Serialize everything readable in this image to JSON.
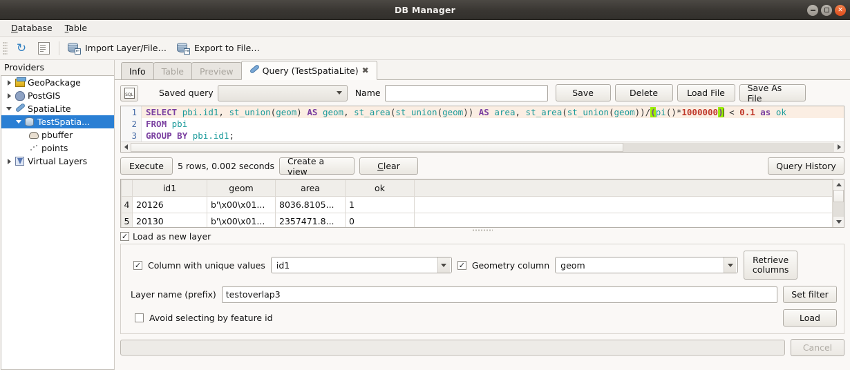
{
  "window": {
    "title": "DB Manager",
    "buttons": {
      "minimize": "minimize-icon",
      "maximize": "maximize-icon",
      "close": "close-icon"
    }
  },
  "menubar": [
    {
      "label": "Database",
      "accel": "D"
    },
    {
      "label": "Table",
      "accel": "T"
    }
  ],
  "toolbar": {
    "refresh_icon": "refresh-icon",
    "sql_window_icon": "sql-window-icon",
    "import_label": "Import Layer/File…",
    "export_label": "Export to File…"
  },
  "sidebar": {
    "title": "Providers",
    "items": [
      {
        "label": "GeoPackage",
        "icon": "geopackage-icon",
        "indent": 1,
        "expander": "collapsed",
        "selected": false
      },
      {
        "label": "PostGIS",
        "icon": "postgis-icon",
        "indent": 1,
        "expander": "collapsed",
        "selected": false
      },
      {
        "label": "SpatiaLite",
        "icon": "spatialite-icon",
        "indent": 1,
        "expander": "expanded",
        "selected": false
      },
      {
        "label": "TestSpatia...",
        "icon": "database-icon",
        "indent": 2,
        "expander": "expanded",
        "selected": true
      },
      {
        "label": "pbuffer",
        "icon": "polygon-icon",
        "indent": 3,
        "expander": "none",
        "selected": false
      },
      {
        "label": "points",
        "icon": "points-icon",
        "indent": 3,
        "expander": "none",
        "selected": false
      },
      {
        "label": "Virtual Layers",
        "icon": "virtual-layers-icon",
        "indent": 1,
        "expander": "collapsed",
        "selected": false
      }
    ]
  },
  "tabs": [
    {
      "label": "Info",
      "state": "enabled",
      "closable": false
    },
    {
      "label": "Table",
      "state": "disabled",
      "closable": false
    },
    {
      "label": "Preview",
      "state": "disabled",
      "closable": false
    },
    {
      "label": "Query (TestSpatiaLite)",
      "state": "active",
      "closable": true,
      "icon": "feather-icon",
      "close_glyph": "✖"
    }
  ],
  "query_panel": {
    "sql_button_icon": "sql-icon",
    "sql_button_text": "SQL",
    "saved_query_label": "Saved query",
    "saved_query_value": "",
    "name_label": "Name",
    "name_value": "",
    "buttons": {
      "save": "Save",
      "delete": "Delete",
      "load_file": "Load File",
      "save_as_file": "Save As File"
    },
    "editor": {
      "line_numbers": [
        "1",
        "2",
        "3"
      ],
      "lines": [
        "SELECT pbi.id1, st_union(geom) AS geom, st_area(st_union(geom)) AS area, st_area(st_union(geom))/(pi()*1000000) < 0.1 as ok",
        "FROM pbi",
        "GROUP BY pbi.id1;"
      ],
      "line1_tokens": [
        {
          "t": "SELECT",
          "c": "kw"
        },
        {
          "t": " ",
          "c": "op"
        },
        {
          "t": "pbi.id1",
          "c": "id"
        },
        {
          "t": ", ",
          "c": "op"
        },
        {
          "t": "st_union",
          "c": "fn"
        },
        {
          "t": "(",
          "c": "op"
        },
        {
          "t": "geom",
          "c": "id"
        },
        {
          "t": ") ",
          "c": "op"
        },
        {
          "t": "AS",
          "c": "kw"
        },
        {
          "t": " ",
          "c": "op"
        },
        {
          "t": "geom",
          "c": "id"
        },
        {
          "t": ", ",
          "c": "op"
        },
        {
          "t": "st_area",
          "c": "fn"
        },
        {
          "t": "(",
          "c": "op"
        },
        {
          "t": "st_union",
          "c": "fn"
        },
        {
          "t": "(",
          "c": "op"
        },
        {
          "t": "geom",
          "c": "id"
        },
        {
          "t": ")) ",
          "c": "op"
        },
        {
          "t": "AS",
          "c": "kw"
        },
        {
          "t": " ",
          "c": "op"
        },
        {
          "t": "area",
          "c": "id"
        },
        {
          "t": ", ",
          "c": "op"
        },
        {
          "t": "st_area",
          "c": "fn"
        },
        {
          "t": "(",
          "c": "op"
        },
        {
          "t": "st_union",
          "c": "fn"
        },
        {
          "t": "(",
          "c": "op"
        },
        {
          "t": "geom",
          "c": "id"
        },
        {
          "t": "))/",
          "c": "op"
        },
        {
          "t": "(",
          "c": "hl"
        },
        {
          "t": "pi",
          "c": "fn"
        },
        {
          "t": "()*",
          "c": "op"
        },
        {
          "t": "1000000",
          "c": "num"
        },
        {
          "t": ")",
          "c": "hl"
        },
        {
          "t": " < ",
          "c": "op"
        },
        {
          "t": "0.1",
          "c": "num"
        },
        {
          "t": " ",
          "c": "op"
        },
        {
          "t": "as",
          "c": "kw"
        },
        {
          "t": " ",
          "c": "op"
        },
        {
          "t": "ok",
          "c": "id"
        }
      ],
      "line2_tokens": [
        {
          "t": "FROM",
          "c": "kw"
        },
        {
          "t": " ",
          "c": "op"
        },
        {
          "t": "pbi",
          "c": "id"
        }
      ],
      "line3_tokens": [
        {
          "t": "GROUP",
          "c": "kw"
        },
        {
          "t": " ",
          "c": "op"
        },
        {
          "t": "BY",
          "c": "kw"
        },
        {
          "t": " ",
          "c": "op"
        },
        {
          "t": "pbi.id1",
          "c": "id"
        },
        {
          "t": ";",
          "c": "op"
        }
      ]
    },
    "execute_row": {
      "execute": "Execute",
      "status": "5 rows, 0.002 seconds",
      "create_view": "Create a view",
      "clear": "Clear",
      "clear_accel": "C",
      "query_history": "Query History"
    },
    "results": {
      "columns": [
        "id1",
        "geom",
        "area",
        "ok"
      ],
      "rows": [
        {
          "num": "4",
          "cells": [
            "20126",
            "b'\\x00\\x01...",
            "8036.8105...",
            "1"
          ]
        },
        {
          "num": "5",
          "cells": [
            "20130",
            "b'\\x00\\x01...",
            "2357471.8...",
            "0"
          ]
        }
      ]
    },
    "load_as_new_layer": {
      "label": "Load as new layer",
      "checked": true
    },
    "unique_column": {
      "label": "Column with unique values",
      "checked": true,
      "value": "id1"
    },
    "geometry_column": {
      "label": "Geometry column",
      "checked": true,
      "value": "geom"
    },
    "layer_name": {
      "label": "Layer name (prefix)",
      "value": "testoverlap3"
    },
    "avoid_feature_id": {
      "label": "Avoid selecting by feature id",
      "checked": false
    },
    "side_buttons": {
      "retrieve_columns_line1": "Retrieve",
      "retrieve_columns_line2": "columns",
      "set_filter": "Set filter",
      "load": "Load"
    },
    "footer": {
      "progress_value": "",
      "cancel": "Cancel",
      "cancel_disabled": true
    }
  },
  "colors": {
    "titlebar": "#393632",
    "selection": "#2a7fd4",
    "keyword": "#7a3fa0",
    "function": "#1a9a9a",
    "number": "#c0392b",
    "paren_highlight": "#9bf000",
    "current_line": "#fbeee3",
    "window_bg": "#f6f4f1"
  }
}
